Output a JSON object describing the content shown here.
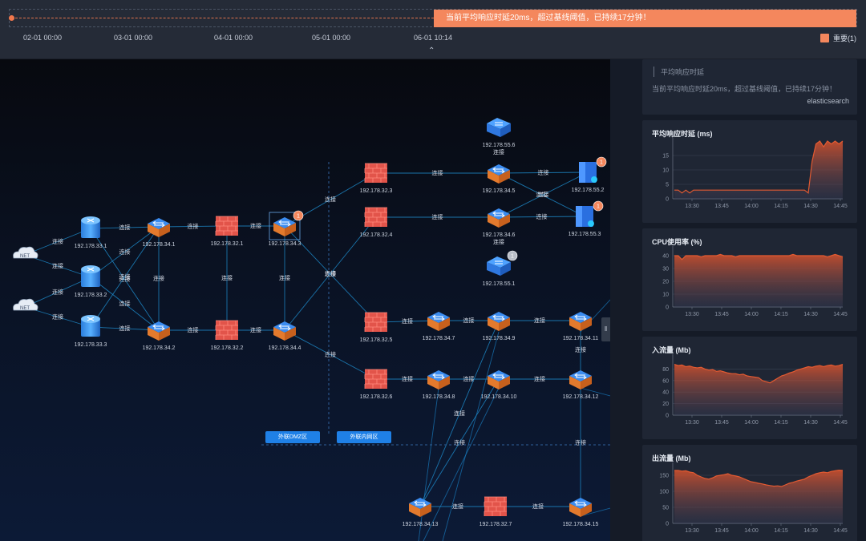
{
  "timeline": {
    "ticks": [
      "02-01 00:00",
      "03-01 00:00",
      "04-01 00:00",
      "05-01 00:00",
      "06-01 10:14"
    ],
    "alert_text": "当前平均响应时延20ms，超过基线阈值，已持续17分钟！",
    "expand_glyph": "⌃",
    "legend_label": "重要(1)",
    "legend_color": "#f4875d"
  },
  "topology": {
    "link_label": "连接",
    "nodes": [
      {
        "id": "net1",
        "type": "net",
        "label": "NET"
      },
      {
        "id": "net2",
        "type": "net",
        "label": "NET"
      },
      {
        "id": "n33_1",
        "type": "server",
        "label": "192.178.33.1"
      },
      {
        "id": "n33_2",
        "type": "server",
        "label": "192.178.33.2"
      },
      {
        "id": "n33_3",
        "type": "server",
        "label": "192.178.33.3"
      },
      {
        "id": "n34_1",
        "type": "switch",
        "label": "192.178.34.1"
      },
      {
        "id": "n34_2",
        "type": "switch",
        "label": "192.178.34.2"
      },
      {
        "id": "n32_1",
        "type": "firewall",
        "label": "192.178.32.1"
      },
      {
        "id": "n32_2",
        "type": "firewall",
        "label": "192.178.32.2"
      },
      {
        "id": "n34_3",
        "type": "switch",
        "label": "192.178.34.3",
        "badge": "1",
        "badge_color": "#f4875d"
      },
      {
        "id": "n34_4",
        "type": "switch",
        "label": "192.178.34.4"
      },
      {
        "id": "n32_3",
        "type": "firewall",
        "label": "192.178.32.3"
      },
      {
        "id": "n32_4",
        "type": "firewall",
        "label": "192.178.32.4"
      },
      {
        "id": "n32_5",
        "type": "firewall",
        "label": "192.178.32.5"
      },
      {
        "id": "n32_6",
        "type": "firewall",
        "label": "192.178.32.6"
      },
      {
        "id": "n55_6",
        "type": "router",
        "label": "192.178.55.6",
        "sub": "连接"
      },
      {
        "id": "n34_5",
        "type": "switch",
        "label": "192.178.34.5"
      },
      {
        "id": "n34_6",
        "type": "switch",
        "label": "192.178.34.6",
        "sub": "连接"
      },
      {
        "id": "n55_2",
        "type": "host",
        "label": "192.178.55.2",
        "badge": "1",
        "badge_color": "#f4875d"
      },
      {
        "id": "n55_3",
        "type": "host",
        "label": "192.178.55.3",
        "badge": "1",
        "badge_color": "#f4875d"
      },
      {
        "id": "n55_1",
        "type": "router",
        "label": "192.178.55.1",
        "badge": "1",
        "badge_color": "#b9bec8"
      },
      {
        "id": "n34_7",
        "type": "switch",
        "label": "192.178.34.7"
      },
      {
        "id": "n34_8",
        "type": "switch",
        "label": "192.178.34.8"
      },
      {
        "id": "n34_9",
        "type": "switch",
        "label": "192.178.34.9"
      },
      {
        "id": "n34_10",
        "type": "switch",
        "label": "192.178.34.10"
      },
      {
        "id": "n34_11",
        "type": "switch",
        "label": "192.178.34.11"
      },
      {
        "id": "n34_12",
        "type": "switch",
        "label": "192.178.34.12"
      },
      {
        "id": "n34_13",
        "type": "switch",
        "label": "192.178.34.13"
      },
      {
        "id": "n32_7",
        "type": "firewall",
        "label": "192.178.32.7"
      },
      {
        "id": "n34_15",
        "type": "switch",
        "label": "192.178.34.15"
      }
    ],
    "links": [
      [
        "net1",
        "n33_1"
      ],
      [
        "net1",
        "n33_2"
      ],
      [
        "net2",
        "n33_2"
      ],
      [
        "net2",
        "n33_3"
      ],
      [
        "n33_1",
        "n34_1"
      ],
      [
        "n33_1",
        "n34_2"
      ],
      [
        "n33_2",
        "n34_1"
      ],
      [
        "n33_2",
        "n34_2"
      ],
      [
        "n33_3",
        "n34_1"
      ],
      [
        "n33_3",
        "n34_2"
      ],
      [
        "n34_1",
        "n34_2"
      ],
      [
        "n34_1",
        "n32_1"
      ],
      [
        "n34_2",
        "n32_2"
      ],
      [
        "n32_1",
        "n32_2"
      ],
      [
        "n32_1",
        "n34_3"
      ],
      [
        "n32_2",
        "n34_4"
      ],
      [
        "n34_3",
        "n34_4"
      ],
      [
        "n34_3",
        "n32_3"
      ],
      [
        "n34_3",
        "n32_5"
      ],
      [
        "n34_4",
        "n32_4"
      ],
      [
        "n34_4",
        "n32_6"
      ],
      [
        "n32_3",
        "n34_5"
      ],
      [
        "n32_4",
        "n34_6"
      ],
      [
        "n34_5",
        "n55_2"
      ],
      [
        "n34_5",
        "n55_3"
      ],
      [
        "n34_6",
        "n55_2"
      ],
      [
        "n34_6",
        "n55_3"
      ],
      [
        "n32_5",
        "n34_7"
      ],
      [
        "n34_7",
        "n34_9"
      ],
      [
        "n34_9",
        "n34_11"
      ],
      [
        "n32_6",
        "n34_8"
      ],
      [
        "n34_8",
        "n34_10"
      ],
      [
        "n34_10",
        "n34_12"
      ],
      [
        "n34_11",
        "n34_12"
      ],
      [
        "n34_9",
        "n34_13"
      ],
      [
        "n34_10",
        "n34_13"
      ],
      [
        "n34_13",
        "n32_7"
      ],
      [
        "n32_7",
        "n34_15"
      ],
      [
        "n34_12",
        "n34_15"
      ]
    ]
  },
  "zones": {
    "dmz": "外联DMZ区",
    "intranet": "外联内网区"
  },
  "collapse_glyph": "‖",
  "panel": {
    "alert_card": {
      "title": "平均响应时延",
      "message": "当前平均响应时延20ms，超过基线阈值，已持续17分钟！",
      "source": "elasticsearch"
    },
    "charts": [
      {
        "id": "latency",
        "title": "平均响应时延 (ms)"
      },
      {
        "id": "cpu",
        "title": "CPU使用率 (%)"
      },
      {
        "id": "in",
        "title": "入流量 (Mb)"
      },
      {
        "id": "out",
        "title": "出流量 (Mb)"
      }
    ]
  },
  "chart_data": [
    {
      "type": "area",
      "title": "平均响应时延 (ms)",
      "x": [
        "13:30",
        "13:45",
        "14:00",
        "14:15",
        "14:30",
        "14:45"
      ],
      "ylim": [
        0,
        20
      ],
      "yticks": [
        0,
        5,
        10,
        15
      ],
      "values": [
        3,
        3,
        2,
        3,
        2,
        3,
        3,
        3,
        3,
        3,
        3,
        3,
        3,
        3,
        3,
        3,
        3,
        3,
        3,
        3,
        3,
        3,
        3,
        3,
        3,
        3,
        3,
        3,
        3,
        3,
        3,
        3,
        3,
        3,
        3,
        2,
        13,
        19,
        20,
        18,
        20,
        19,
        20,
        19,
        20
      ]
    },
    {
      "type": "area",
      "title": "CPU使用率 (%)",
      "x": [
        "13:30",
        "13:45",
        "14:00",
        "14:15",
        "14:30",
        "14:45"
      ],
      "ylim": [
        0,
        45
      ],
      "yticks": [
        0,
        10,
        20,
        30,
        40
      ],
      "values": [
        40,
        40,
        37,
        40,
        40,
        40,
        40,
        39,
        40,
        40,
        40,
        40,
        41,
        40,
        40,
        40,
        39,
        40,
        40,
        40,
        40,
        40,
        40,
        40,
        40,
        40,
        40,
        40,
        40,
        40,
        40,
        41,
        40,
        40,
        40,
        40,
        40,
        40,
        40,
        40,
        39,
        40,
        41,
        40,
        39
      ]
    },
    {
      "type": "area",
      "title": "入流量 (Mb)",
      "x": [
        "13:30",
        "13:45",
        "14:00",
        "14:15",
        "14:30",
        "14:45"
      ],
      "ylim": [
        0,
        100
      ],
      "yticks": [
        0,
        20,
        40,
        60,
        80
      ],
      "values": [
        88,
        86,
        87,
        84,
        85,
        83,
        82,
        83,
        80,
        78,
        79,
        76,
        77,
        75,
        73,
        72,
        72,
        70,
        71,
        68,
        67,
        66,
        65,
        60,
        58,
        56,
        60,
        64,
        68,
        70,
        73,
        75,
        78,
        80,
        82,
        84,
        83,
        85,
        86,
        84,
        86,
        87,
        85,
        86,
        88
      ]
    },
    {
      "type": "area",
      "title": "出流量 (Mb)",
      "x": [
        "13:30",
        "13:45",
        "14:00",
        "14:15",
        "14:30",
        "14:45"
      ],
      "ylim": [
        0,
        180
      ],
      "yticks": [
        0,
        50,
        100,
        150
      ],
      "values": [
        165,
        165,
        163,
        164,
        160,
        158,
        150,
        145,
        140,
        138,
        142,
        148,
        150,
        152,
        155,
        150,
        148,
        145,
        140,
        135,
        130,
        128,
        125,
        123,
        120,
        118,
        116,
        117,
        115,
        120,
        125,
        128,
        132,
        135,
        138,
        145,
        150,
        155,
        158,
        160,
        158,
        162,
        164,
        166,
        165
      ]
    }
  ],
  "colors": {
    "accent": "#f4875d",
    "line": "#e25a32",
    "link": "#1e90c8",
    "panel": "#1f2634"
  }
}
